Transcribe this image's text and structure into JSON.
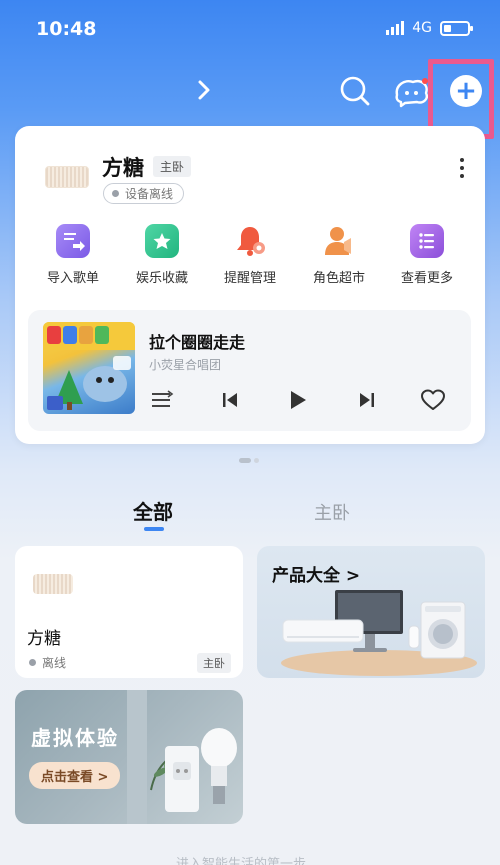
{
  "status_bar": {
    "time": "10:48",
    "network": "4G"
  },
  "top_nav": {
    "chevron_icon": "chevron-right-icon",
    "search_icon": "search-icon",
    "assistant_icon": "assistant-icon",
    "add_icon": "plus-icon",
    "add_symbol": "+"
  },
  "device_card": {
    "name": "方糖",
    "room": "主卧",
    "status": "设备离线",
    "quick_actions": [
      {
        "label": "导入歌单",
        "icon": "import-playlist-icon",
        "color": "#8b6cf0"
      },
      {
        "label": "娱乐收藏",
        "icon": "star-folder-icon",
        "color": "#2dbf8a"
      },
      {
        "label": "提醒管理",
        "icon": "bell-icon",
        "color": "#f0654a"
      },
      {
        "label": "角色超市",
        "icon": "character-icon",
        "color": "#f0924a"
      },
      {
        "label": "查看更多",
        "icon": "more-list-icon",
        "color": "#a35fe0"
      }
    ],
    "player": {
      "song_title": "拉个圈圈走走",
      "artist": "小荧星合唱团"
    }
  },
  "tabs": [
    {
      "label": "全部",
      "active": true
    },
    {
      "label": "主卧",
      "active": false
    }
  ],
  "device_tile": {
    "name": "方糖",
    "status": "离线",
    "room": "主卧"
  },
  "products_tile": {
    "title": "产品大全 >"
  },
  "virtual_tile": {
    "title": "虚拟体验",
    "button": "点击查看 >"
  },
  "footer_hint": "进入智能生活的第一步"
}
